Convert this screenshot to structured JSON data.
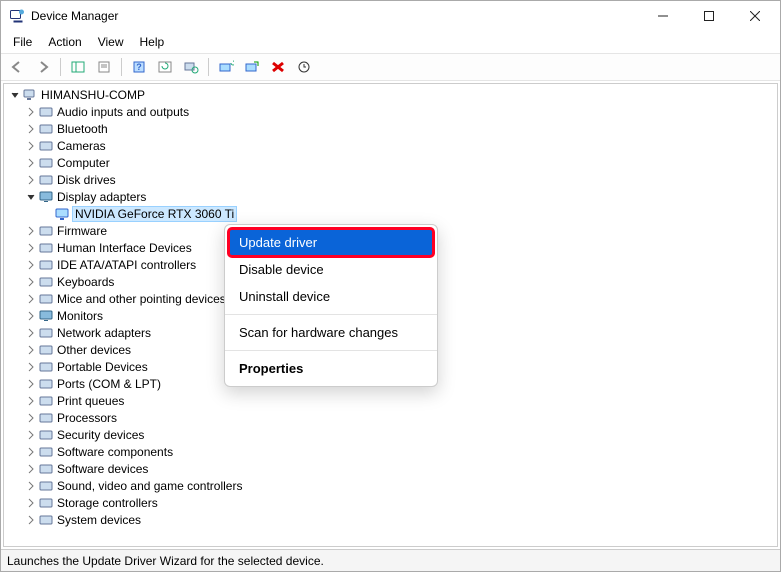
{
  "window": {
    "title": "Device Manager"
  },
  "menu": {
    "file": "File",
    "action": "Action",
    "view": "View",
    "help": "Help"
  },
  "toolbar_icons": {
    "back": "back-arrow-icon",
    "forward": "forward-arrow-icon",
    "show_hide": "show-hide-pane-icon",
    "properties": "properties-sheet-icon",
    "help": "help-icon",
    "refresh": "refresh-icon",
    "scan": "scan-hardware-icon",
    "update": "update-driver-icon",
    "enable": "enable-device-icon",
    "uninstall": "uninstall-x-icon",
    "disable": "disable-arrow-icon"
  },
  "tree": {
    "root": "HIMANSHU-COMP",
    "items": [
      {
        "label": "Audio inputs and outputs",
        "expanded": false
      },
      {
        "label": "Bluetooth",
        "expanded": false
      },
      {
        "label": "Cameras",
        "expanded": false
      },
      {
        "label": "Computer",
        "expanded": false
      },
      {
        "label": "Disk drives",
        "expanded": false
      },
      {
        "label": "Display adapters",
        "expanded": true,
        "children": [
          {
            "label": "NVIDIA GeForce RTX 3060 Ti",
            "selected": true
          }
        ]
      },
      {
        "label": "Firmware",
        "expanded": false
      },
      {
        "label": "Human Interface Devices",
        "expanded": false
      },
      {
        "label": "IDE ATA/ATAPI controllers",
        "expanded": false
      },
      {
        "label": "Keyboards",
        "expanded": false
      },
      {
        "label": "Mice and other pointing devices",
        "expanded": false
      },
      {
        "label": "Monitors",
        "expanded": false
      },
      {
        "label": "Network adapters",
        "expanded": false
      },
      {
        "label": "Other devices",
        "expanded": false
      },
      {
        "label": "Portable Devices",
        "expanded": false
      },
      {
        "label": "Ports (COM & LPT)",
        "expanded": false
      },
      {
        "label": "Print queues",
        "expanded": false
      },
      {
        "label": "Processors",
        "expanded": false
      },
      {
        "label": "Security devices",
        "expanded": false
      },
      {
        "label": "Software components",
        "expanded": false
      },
      {
        "label": "Software devices",
        "expanded": false
      },
      {
        "label": "Sound, video and game controllers",
        "expanded": false
      },
      {
        "label": "Storage controllers",
        "expanded": false
      },
      {
        "label": "System devices",
        "expanded": false
      }
    ]
  },
  "context_menu": {
    "items": [
      {
        "label": "Update driver",
        "highlight": true
      },
      {
        "label": "Disable device"
      },
      {
        "label": "Uninstall device"
      },
      {
        "sep": true
      },
      {
        "label": "Scan for hardware changes"
      },
      {
        "sep": true
      },
      {
        "label": "Properties",
        "bold": true
      }
    ]
  },
  "status": "Launches the Update Driver Wizard for the selected device."
}
